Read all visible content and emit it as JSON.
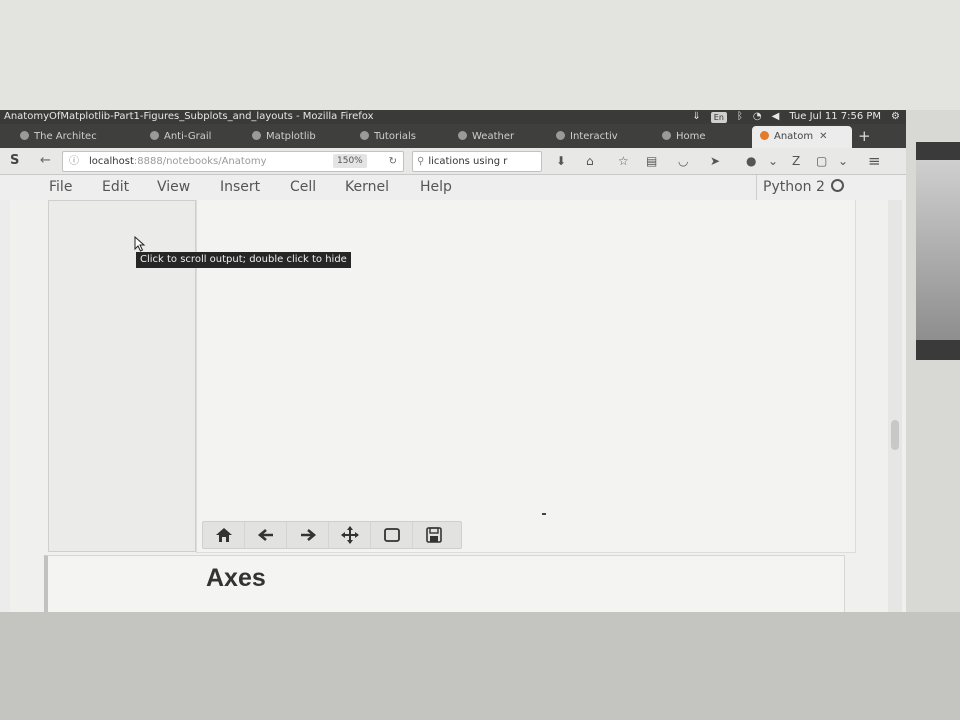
{
  "window": {
    "title": "AnatomyOfMatplotlib-Part1-Figures_Subplots_and_layouts - Mozilla Firefox",
    "tray": {
      "keyboard_layout": "En",
      "clock": "Tue Jul 11 7:56 PM"
    }
  },
  "tabs": [
    {
      "label": "The Architec",
      "icon": "page-icon"
    },
    {
      "label": "Anti-Grail",
      "icon": "page-icon"
    },
    {
      "label": "Matplotlib",
      "icon": "page-icon"
    },
    {
      "label": "Tutorials",
      "icon": "page-icon"
    },
    {
      "label": "Weather",
      "icon": "page-icon"
    },
    {
      "label": "Interactiv",
      "icon": "page-icon"
    },
    {
      "label": "Home",
      "icon": "page-icon"
    },
    {
      "label": "Anatom",
      "icon": "jupyter-icon",
      "active": true
    }
  ],
  "navbar": {
    "url_host": "localhost",
    "url_port": ":8888",
    "url_path": "/notebooks/Anatomy",
    "zoom": "150%",
    "search_text": "lications using r"
  },
  "menu": {
    "items": [
      "File",
      "Edit",
      "View",
      "Insert",
      "Cell",
      "Kernel",
      "Help"
    ],
    "kernel_name": "Python 2"
  },
  "tooltip": {
    "text": "Click to scroll output; double click to hide"
  },
  "figure_toolbar": {
    "buttons": [
      {
        "name": "home-button",
        "icon": "home-icon"
      },
      {
        "name": "back-button",
        "icon": "arrow-left-icon"
      },
      {
        "name": "forward-button",
        "icon": "arrow-right-icon"
      },
      {
        "name": "pan-button",
        "icon": "move-icon"
      },
      {
        "name": "zoom-rect-button",
        "icon": "rectangle-icon"
      },
      {
        "name": "save-button",
        "icon": "floppy-icon"
      }
    ]
  },
  "markdown": {
    "heading": "Axes"
  }
}
